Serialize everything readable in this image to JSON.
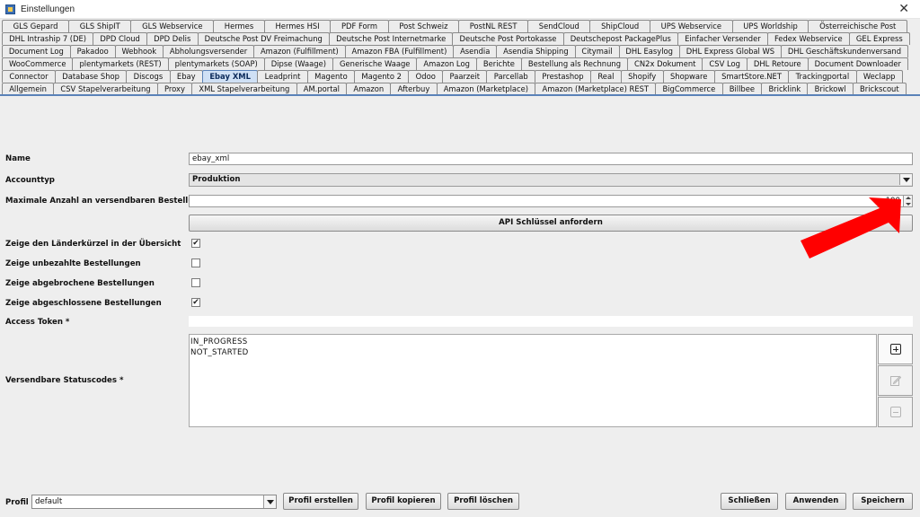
{
  "window": {
    "title": "Einstellungen",
    "close_glyph": "✕"
  },
  "tabs": {
    "rows": [
      [
        "GLS Gepard",
        "GLS ShipIT",
        "GLS Webservice",
        "Hermes",
        "Hermes HSI",
        "PDF Form",
        "Post Schweiz",
        "PostNL REST",
        "SendCloud",
        "ShipCloud",
        "UPS Webservice",
        "UPS Worldship",
        "Österreichische Post"
      ],
      [
        "DHL Intraship 7 (DE)",
        "DPD Cloud",
        "DPD Delis",
        "Deutsche Post DV Freimachung",
        "Deutsche Post Internetmarke",
        "Deutsche Post Portokasse",
        "Deutschepost PackagePlus",
        "Einfacher Versender",
        "Fedex Webservice",
        "GEL Express"
      ],
      [
        "Document Log",
        "Pakadoo",
        "Webhook",
        "Abholungsversender",
        "Amazon (Fulfillment)",
        "Amazon FBA (Fulfillment)",
        "Asendia",
        "Asendia Shipping",
        "Citymail",
        "DHL Easylog",
        "DHL Express Global WS",
        "DHL Geschäftskundenversand"
      ],
      [
        "WooCommerce",
        "plentymarkets (REST)",
        "plentymarkets (SOAP)",
        "Dipse (Waage)",
        "Generische Waage",
        "Amazon Log",
        "Berichte",
        "Bestellung als Rechnung",
        "CN2x Dokument",
        "CSV Log",
        "DHL Retoure",
        "Document Downloader"
      ],
      [
        "Connector",
        "Database Shop",
        "Discogs",
        "Ebay",
        "Ebay XML",
        "Leadprint",
        "Magento",
        "Magento 2",
        "Odoo",
        "Paarzeit",
        "Parcellab",
        "Prestashop",
        "Real",
        "Shopify",
        "Shopware",
        "SmartStore.NET",
        "Trackingportal",
        "Weclapp"
      ],
      [
        "Allgemein",
        "CSV Stapelverarbeitung",
        "Proxy",
        "XML Stapelverarbeitung",
        "AM.portal",
        "Amazon",
        "Afterbuy",
        "Amazon (Marketplace)",
        "Amazon (Marketplace) REST",
        "BigCommerce",
        "Billbee",
        "Bricklink",
        "Brickowl",
        "Brickscout"
      ]
    ],
    "active": "Ebay XML"
  },
  "form": {
    "name_label": "Name",
    "name_value": "ebay_xml",
    "accounttyp_label": "Accounttyp",
    "accounttyp_value": "Produktion",
    "max_label": "Maximale Anzahl an versendbaren Bestellungen",
    "max_value": "100",
    "api_button": "API Schlüssel anfordern",
    "cb_laender_label": "Zeige den Länderkürzel in der Übersicht",
    "cb_laender_checked": true,
    "cb_unbezahlt_label": "Zeige unbezahlte Bestellungen",
    "cb_unbezahlt_checked": false,
    "cb_abgebrochen_label": "Zeige abgebrochene Bestellungen",
    "cb_abgebrochen_checked": false,
    "cb_abgeschlossen_label": "Zeige abgeschlossene Bestellungen",
    "cb_abgeschlossen_checked": true,
    "access_token_label": "Access Token *",
    "access_token_value": "",
    "status_label": "Versendbare Statuscodes *",
    "status_codes": [
      "IN_PROGRESS",
      "NOT_STARTED"
    ]
  },
  "side_buttons": {
    "add_icon": "plus-square-icon",
    "edit_icon": "pencil-icon",
    "remove_icon": "minus-square-icon"
  },
  "bottom": {
    "profil_label": "Profil",
    "profil_value": "default",
    "btn_erstellen": "Profil erstellen",
    "btn_kopieren": "Profil kopieren",
    "btn_loeschen": "Profil löschen",
    "btn_schliessen": "Schließen",
    "btn_anwenden": "Anwenden",
    "btn_speichern": "Speichern"
  },
  "colors": {
    "arrow": "#ff0000",
    "active_tab": "#cfe0f5",
    "panel_bg": "#eeeeee"
  }
}
